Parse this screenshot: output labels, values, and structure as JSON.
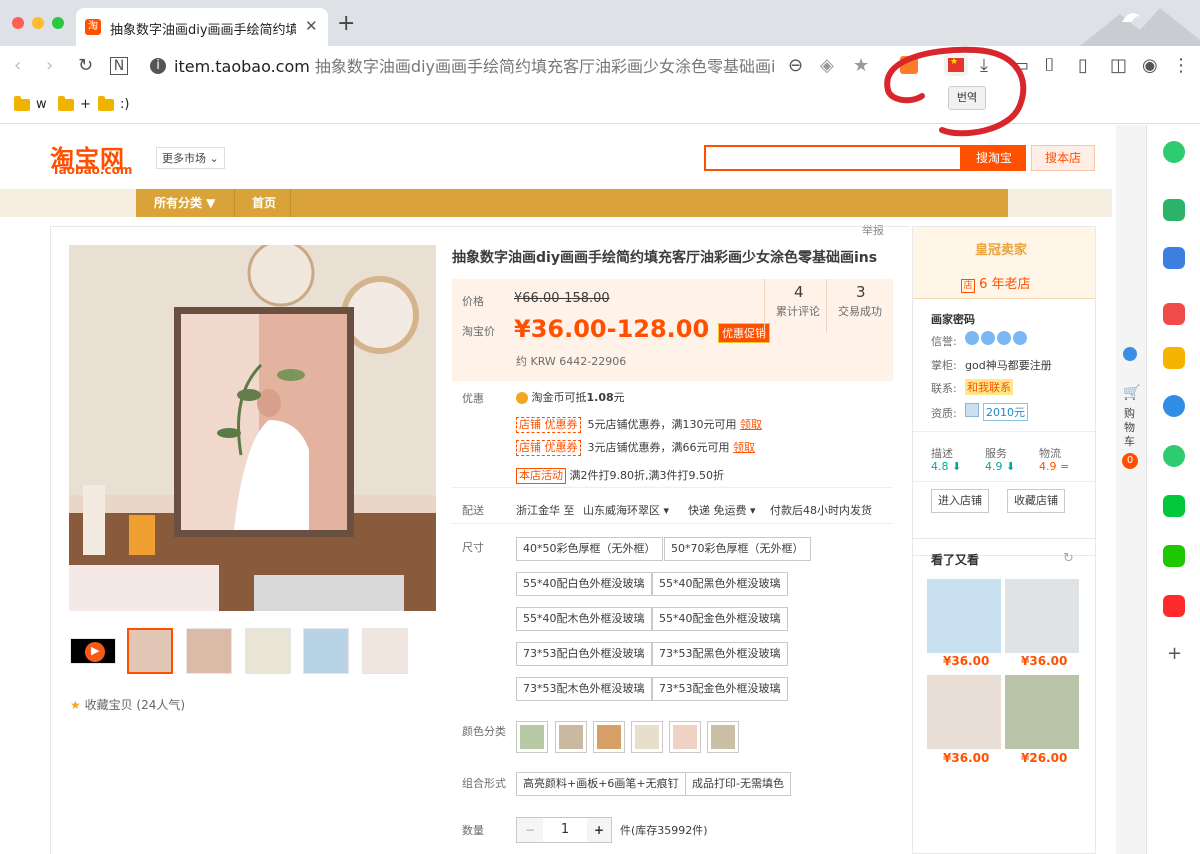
{
  "browser": {
    "tab_title": "抽象数字油画diy画画手绘简约填充客厅油彩画少女涂色零基础画ins-淘宝网",
    "tab_favicon": "淘",
    "url_host": "item.taobao.com",
    "url_path": "抽象数字油画diy画画手绘简约填充客厅油彩画少女涂色零基础画ins-淘宝网",
    "bookmarks": [
      "w",
      "+",
      ":)"
    ],
    "tooltip": "번역"
  },
  "header": {
    "logo_cn": "淘宝网",
    "logo_en": "Taobao.com",
    "market": "更多市场",
    "search_btn": "搜淘宝",
    "search_shop_btn": "搜本店",
    "nav_all": "所有分类 ▼",
    "nav_home": "首页",
    "report": "举报"
  },
  "product": {
    "title": "抽象数字油画diy画画手绘简约填充客厅油彩画少女涂色零基础画ins",
    "price_label": "价格",
    "price_orig": "¥66.00-158.00",
    "tb_label": "淘宝价",
    "tb_price": "¥36.00-128.00",
    "promo_tag": "优惠促销",
    "krw": "约 KRW 6442-22906",
    "reviews_num": "4",
    "reviews_label": "累计评论",
    "deals_num": "3",
    "deals_label": "交易成功",
    "discount_label": "优惠",
    "coin_text": "淘金币可抵",
    "coin_amount": "1.08",
    "coin_unit": "元",
    "coupon_tag": "店铺 优惠券",
    "coupon1": "5元店铺优惠券，满130元可用",
    "coupon2": "3元店铺优惠券，满66元可用",
    "claim": "领取",
    "activity_tag": "本店活动",
    "activity": "满2件打9.80折,满3件打9.50折",
    "ship_label": "配送",
    "ship_from": "浙江金华 至",
    "ship_to": "山东威海环翠区",
    "ship_way": "快递 免运费",
    "ship_time": "付款后48小时内发货",
    "size_label": "尺寸",
    "sizes": [
      "40*50彩色厚框（无外框）",
      "50*70彩色厚框（无外框）",
      "55*40配白色外框没玻璃",
      "55*40配黑色外框没玻璃",
      "55*40配木色外框没玻璃",
      "55*40配金色外框没玻璃",
      "73*53配白色外框没玻璃",
      "73*53配黑色外框没玻璃",
      "73*53配木色外框没玻璃",
      "73*53配金色外框没玻璃"
    ],
    "color_label": "颜色分类",
    "combo_label": "组合形式",
    "combos": [
      "高亮颜料+画板+6画笔+无痕钉",
      "成品打印-无需填色"
    ],
    "qty_label": "数量",
    "qty": "1",
    "stock": "件(库存35992件)",
    "fav_text": "收藏宝贝 (24人气)"
  },
  "shop": {
    "badge": "皇冠卖家",
    "years": "6 年老店",
    "name": "画家密码",
    "credit_label": "信誉:",
    "keeper_label": "掌柜:",
    "keeper": "god神马都要注册",
    "contact_label": "联系:",
    "contact": "和我联系",
    "qual_label": "资质:",
    "qual_year": "2010元",
    "desc_label": "描述",
    "desc_score": "4.8",
    "service_label": "服务",
    "service_score": "4.9",
    "logistics_label": "物流",
    "logistics_score": "4.9",
    "enter_btn": "进入店铺",
    "collect_btn": "收藏店铺",
    "seen_title": "看了又看",
    "seen_prices": [
      "¥36.00",
      "¥36.00",
      "¥36.00",
      "¥26.00"
    ]
  },
  "side": {
    "cart": "购物车",
    "cart_count": "0"
  }
}
